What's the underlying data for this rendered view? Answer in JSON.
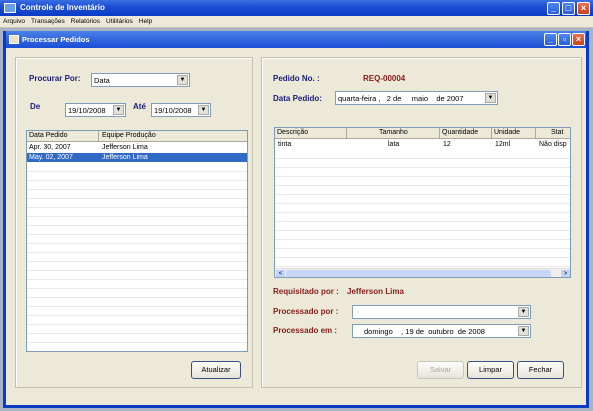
{
  "app": {
    "title": "Controle de Inventário"
  },
  "menu": [
    "Arquivo",
    "Transações",
    "Relatórios",
    "Utilitários",
    "Help"
  ],
  "window": {
    "title": "Processar Pedidos"
  },
  "left": {
    "search_label": "Procurar Por:",
    "search_value": "Data",
    "from_label": "De",
    "from_value": "19/10/2008",
    "to_label": "Até",
    "to_value": "19/10/2008",
    "columns": [
      "Data Pedido",
      "Equipe Produção"
    ],
    "rows": [
      {
        "date": "Apr. 30, 2007",
        "team": "Jefferson Lima"
      },
      {
        "date": "May. 02, 2007",
        "team": "Jefferson Lima"
      }
    ],
    "refresh_button": "Atualizar"
  },
  "right": {
    "order_label": "Pedido  No. :",
    "order_value": "REQ-00004",
    "date_label": "Data Pedido:",
    "date_value": "quarta-feira ,   2 de     maio    de 2007",
    "columns": [
      "Descrição",
      "Tamanho",
      "Quantidade",
      "Unidade",
      "Stat"
    ],
    "items": [
      {
        "desc": "tinta",
        "size": "lata",
        "qty": "12",
        "unit": "12ml",
        "status": "Não disp"
      }
    ],
    "requested_label": "Requisitado por  :",
    "requested_value": "Jefferson Lima",
    "processed_by_label": "Processado por :",
    "processed_by_value": "",
    "processed_on_label": "Processado em :",
    "processed_on_value": "domingo    , 19 de  outubro  de 2008",
    "btn_save": "Salvar",
    "btn_clear": "Limpar",
    "btn_close": "Fechar"
  },
  "colors": {
    "title_blue": "#0a3bc4",
    "label_blue": "#1a1a80",
    "label_red": "#8b1a1a",
    "selection": "#316ac5"
  }
}
